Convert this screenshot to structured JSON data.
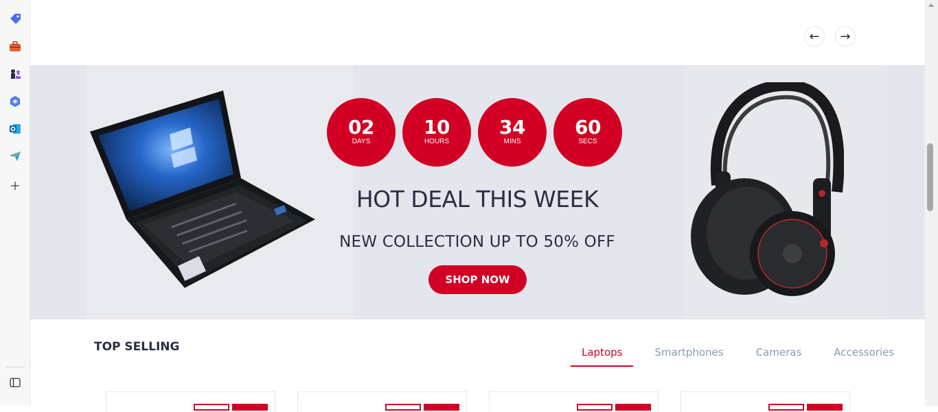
{
  "browser_sidebar": {
    "icons": [
      "tag-icon",
      "briefcase-icon",
      "chess-icon",
      "copilot-icon",
      "outlook-icon",
      "send-icon",
      "add-icon"
    ],
    "bottom_icon": "sidebar-toggle-icon"
  },
  "slider_nav": {
    "prev_label": "←",
    "next_label": "→"
  },
  "deal": {
    "countdown": [
      {
        "value": "02",
        "label": "DAYS"
      },
      {
        "value": "10",
        "label": "HOURS"
      },
      {
        "value": "34",
        "label": "MINS"
      },
      {
        "value": "60",
        "label": "SECS"
      }
    ],
    "title": "HOT DEAL THIS WEEK",
    "subtitle": "NEW COLLECTION UP TO 50% OFF",
    "cta_label": "SHOP NOW"
  },
  "top_selling": {
    "title": "TOP SELLING",
    "tabs": [
      {
        "label": "Laptops",
        "active": true
      },
      {
        "label": "Smartphones",
        "active": false
      },
      {
        "label": "Cameras",
        "active": false
      },
      {
        "label": "Accessories",
        "active": false
      }
    ]
  },
  "colors": {
    "primary": "#d10024",
    "headline": "#2b2d42",
    "muted": "#8d99ae",
    "deal_bg": "#e4e6ed"
  }
}
